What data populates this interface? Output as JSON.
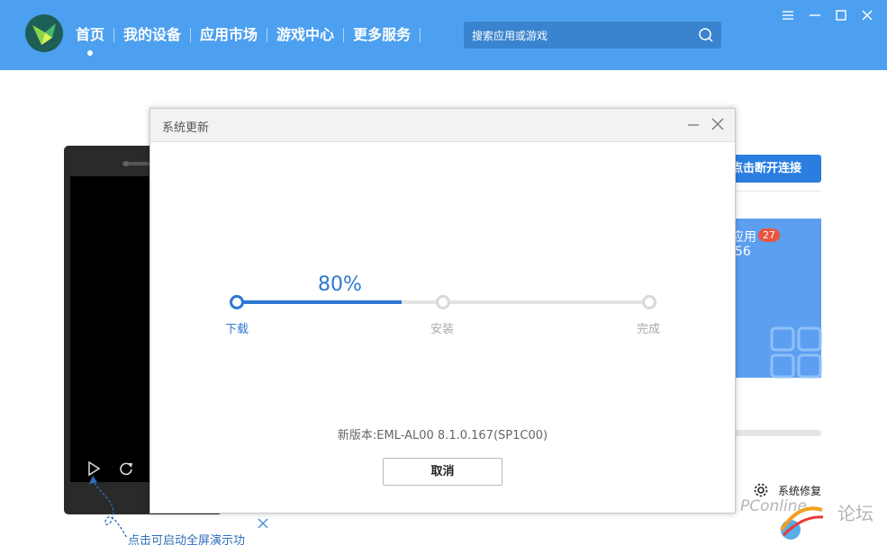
{
  "header": {
    "nav": [
      {
        "label": "首页",
        "active": true
      },
      {
        "label": "我的设备",
        "active": false
      },
      {
        "label": "应用市场",
        "active": false
      },
      {
        "label": "游戏中心",
        "active": false
      },
      {
        "label": "更多服务",
        "active": false
      }
    ],
    "search_placeholder": "搜索应用或游戏",
    "window_controls": [
      "menu-icon",
      "minimize-icon",
      "maximize-icon",
      "close-icon"
    ],
    "accent_color": "#4da0ef"
  },
  "device": {
    "hint": "点击可启动全屏演示功",
    "controls": [
      "play-icon",
      "refresh-icon"
    ]
  },
  "side": {
    "connect_button": "点击断开连接",
    "app_label": "应用",
    "app_badge": "27",
    "app_number": "56",
    "repair_label": "系统修复"
  },
  "dialog": {
    "title": "系统更新",
    "progress_percent": 80,
    "progress_text": "80%",
    "steps": [
      {
        "label": "下载",
        "state": "done"
      },
      {
        "label": "安装",
        "state": "todo"
      },
      {
        "label": "完成",
        "state": "todo"
      }
    ],
    "version": "新版本:EML-AL00 8.1.0.167(SP1C00)",
    "cancel_label": "取消",
    "progress_color": "#2e78d2"
  },
  "watermark": {
    "text": "PConline",
    "forum": "论坛"
  }
}
